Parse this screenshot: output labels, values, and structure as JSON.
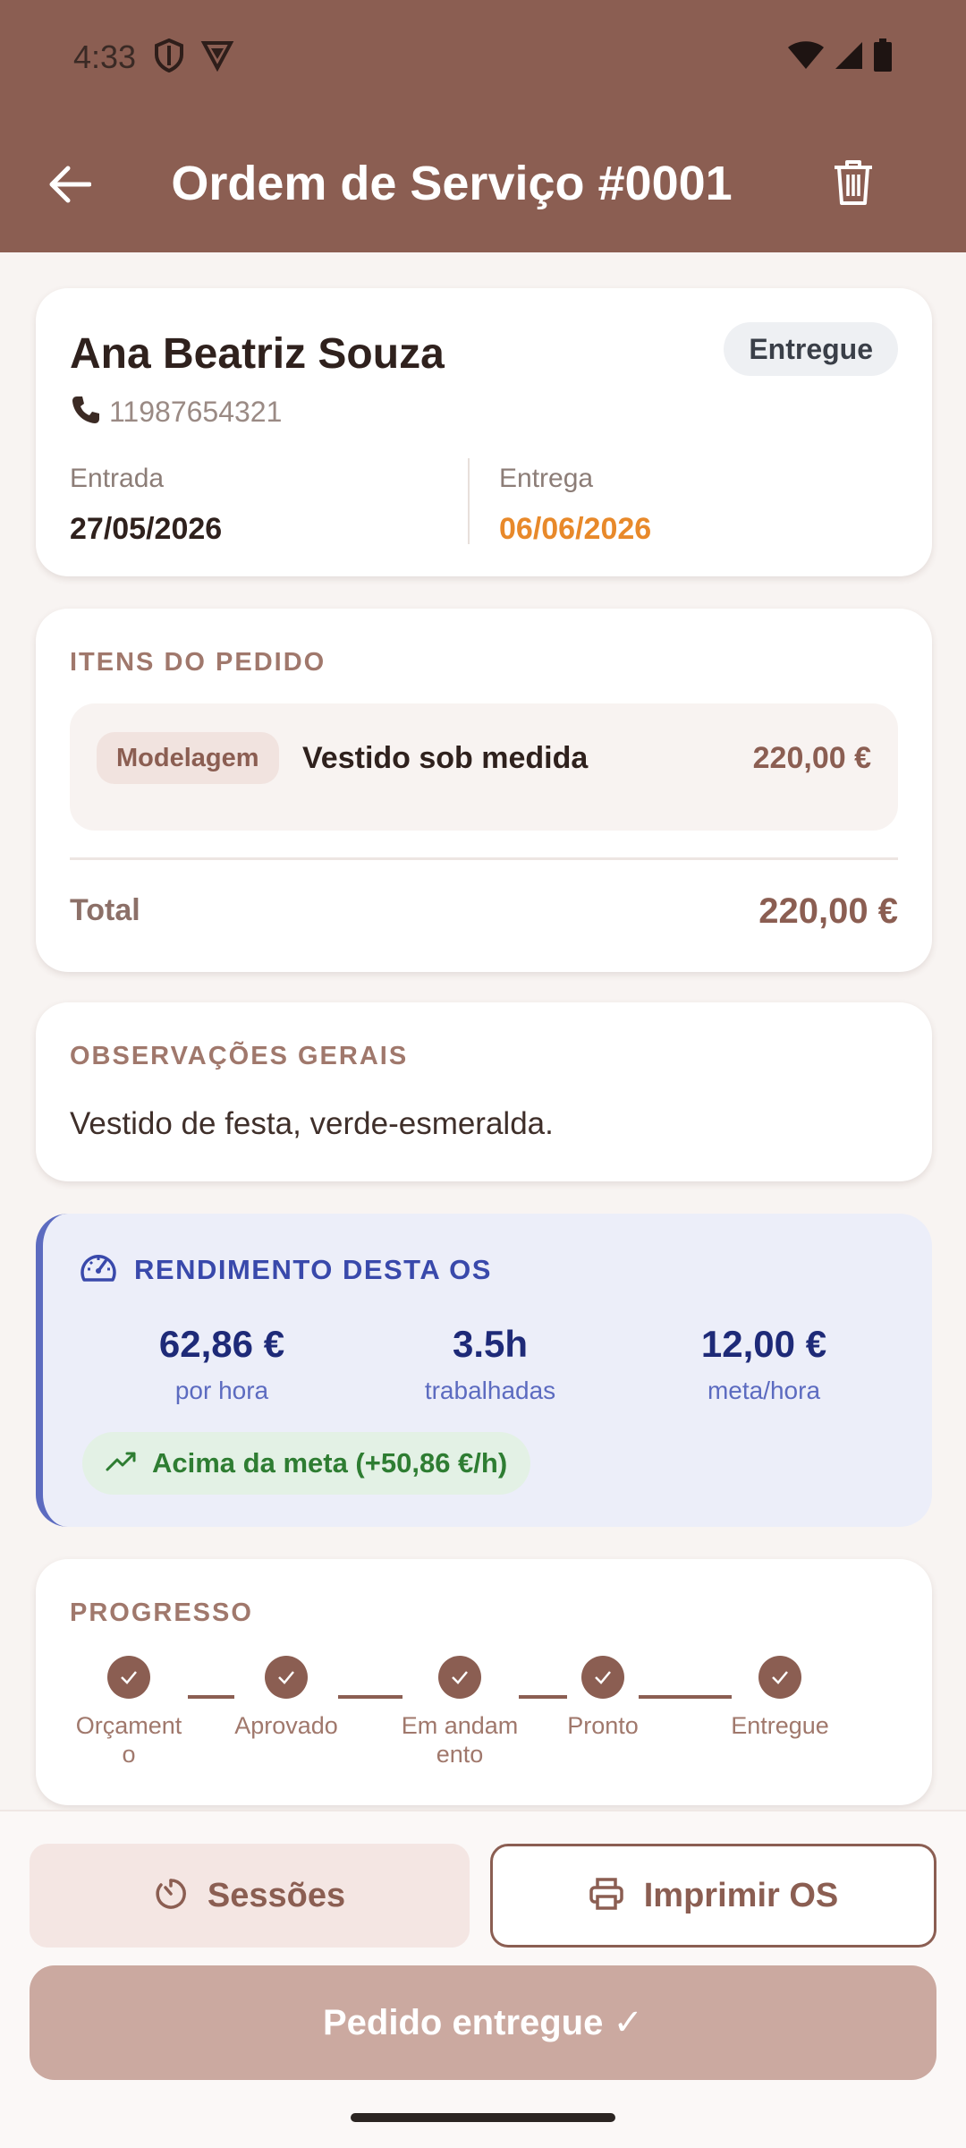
{
  "status_bar": {
    "time": "4:33"
  },
  "header": {
    "title": "Ordem de Serviço #0001"
  },
  "customer": {
    "name": "Ana Beatriz Souza",
    "status": "Entregue",
    "phone": "11987654321",
    "entry_label": "Entrada",
    "entry_date": "27/05/2026",
    "delivery_label": "Entrega",
    "delivery_date": "06/06/2026"
  },
  "items": {
    "title": "ITENS DO PEDIDO",
    "list": [
      {
        "tag": "Modelagem",
        "name": "Vestido sob medida",
        "price": "220,00 €"
      }
    ],
    "total_label": "Total",
    "total_value": "220,00 €"
  },
  "notes": {
    "title": "OBSERVAÇÕES GERAIS",
    "text": "Vestido de festa, verde-esmeralda."
  },
  "yield": {
    "title": "RENDIMENTO DESTA OS",
    "stats": [
      {
        "value": "62,86 €",
        "label": "por hora"
      },
      {
        "value": "3.5h",
        "label": "trabalhadas"
      },
      {
        "value": "12,00 €",
        "label": "meta/hora"
      }
    ],
    "goal_text": "Acima da meta (+50,86 €/h)"
  },
  "progress": {
    "title": "PROGRESSO",
    "steps": [
      {
        "label": "Orçament o"
      },
      {
        "label": "Aprovado"
      },
      {
        "label": "Em andam ento"
      },
      {
        "label": "Pronto"
      },
      {
        "label": "Entregue"
      }
    ]
  },
  "actions": {
    "sessions_label": "Sessões",
    "print_label": "Imprimir OS",
    "delivered_label": "Pedido entregue ✓"
  },
  "colors": {
    "primary": "#8B5E52",
    "accent_orange": "#E8892A",
    "yield_blue": "#3949AB",
    "success_green": "#2E7D32"
  }
}
